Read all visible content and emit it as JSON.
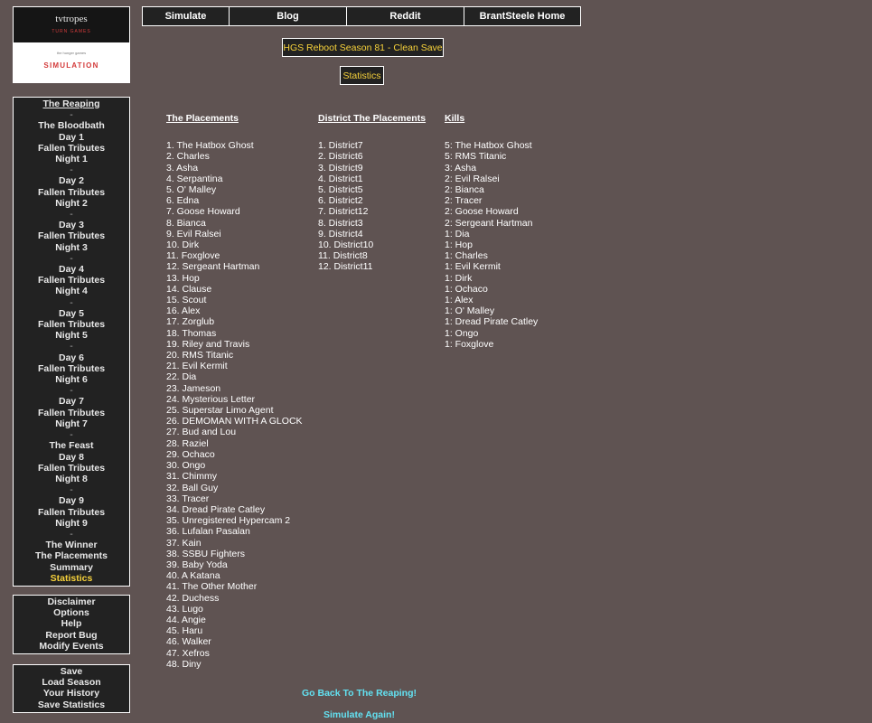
{
  "logo": {
    "tvtropes_text": "tvtropes",
    "tvtropes_sub": "TURN GAMES",
    "sim_text": "SIMULATION",
    "sim_tiny": "the hunger games"
  },
  "top_nav": [
    {
      "label": "Simulate"
    },
    {
      "label": "Blog"
    },
    {
      "label": "Reddit"
    },
    {
      "label": "BrantSteele Home"
    }
  ],
  "season_title": "HGS Reboot Season 81 - Clean Save",
  "page_title": "Statistics",
  "sidebar_nav": [
    {
      "label": "The Reaping",
      "type": "item"
    },
    {
      "label": "-",
      "type": "sep"
    },
    {
      "label": "The Bloodbath",
      "type": "item"
    },
    {
      "label": "Day 1",
      "type": "item"
    },
    {
      "label": "Fallen Tributes",
      "type": "item"
    },
    {
      "label": "Night 1",
      "type": "item"
    },
    {
      "label": "-",
      "type": "sep"
    },
    {
      "label": "Day 2",
      "type": "item"
    },
    {
      "label": "Fallen Tributes",
      "type": "item"
    },
    {
      "label": "Night 2",
      "type": "item"
    },
    {
      "label": "-",
      "type": "sep"
    },
    {
      "label": "Day 3",
      "type": "item"
    },
    {
      "label": "Fallen Tributes",
      "type": "item"
    },
    {
      "label": "Night 3",
      "type": "item"
    },
    {
      "label": "-",
      "type": "sep"
    },
    {
      "label": "Day 4",
      "type": "item"
    },
    {
      "label": "Fallen Tributes",
      "type": "item"
    },
    {
      "label": "Night 4",
      "type": "item"
    },
    {
      "label": "-",
      "type": "sep"
    },
    {
      "label": "Day 5",
      "type": "item"
    },
    {
      "label": "Fallen Tributes",
      "type": "item"
    },
    {
      "label": "Night 5",
      "type": "item"
    },
    {
      "label": "-",
      "type": "sep"
    },
    {
      "label": "Day 6",
      "type": "item"
    },
    {
      "label": "Fallen Tributes",
      "type": "item"
    },
    {
      "label": "Night 6",
      "type": "item"
    },
    {
      "label": "-",
      "type": "sep"
    },
    {
      "label": "Day 7",
      "type": "item"
    },
    {
      "label": "Fallen Tributes",
      "type": "item"
    },
    {
      "label": "Night 7",
      "type": "item"
    },
    {
      "label": "-",
      "type": "sep"
    },
    {
      "label": "The Feast",
      "type": "item"
    },
    {
      "label": "Day 8",
      "type": "item"
    },
    {
      "label": "Fallen Tributes",
      "type": "item"
    },
    {
      "label": "Night 8",
      "type": "item"
    },
    {
      "label": "-",
      "type": "sep"
    },
    {
      "label": "Day 9",
      "type": "item"
    },
    {
      "label": "Fallen Tributes",
      "type": "item"
    },
    {
      "label": "Night 9",
      "type": "item"
    },
    {
      "label": "-",
      "type": "sep"
    },
    {
      "label": "The Winner",
      "type": "item"
    },
    {
      "label": "The Placements",
      "type": "item"
    },
    {
      "label": "Summary",
      "type": "item"
    },
    {
      "label": "Statistics",
      "type": "selected"
    }
  ],
  "sidebar_misc": [
    "Disclaimer",
    "Options",
    "Help",
    "Report Bug",
    "Modify Events"
  ],
  "sidebar_save": [
    "Save",
    "Load Season",
    "Your History",
    "Save Statistics"
  ],
  "placements": {
    "heading": "The Placements",
    "rows": [
      "1. The Hatbox Ghost",
      "2. Charles",
      "3. Asha",
      "4. Serpantina",
      "5. O' Malley",
      "6. Edna",
      "7. Goose Howard",
      "8. Bianca",
      "9. Evil Ralsei",
      "10. Dirk",
      "11. Foxglove",
      "12. Sergeant Hartman",
      "13. Hop",
      "14. Clause",
      "15. Scout",
      "16. Alex",
      "17. Zorglub",
      "18. Thomas",
      "19. Riley and Travis",
      "20. RMS Titanic",
      "21. Evil Kermit",
      "22. Dia",
      "23. Jameson",
      "24. Mysterious Letter",
      "25. Superstar Limo Agent",
      "26. DEMOMAN WITH A GLOCK",
      "27. Bud and Lou",
      "28. Raziel",
      "29. Ochaco",
      "30. Ongo",
      "31. Chimmy",
      "32. Ball Guy",
      "33. Tracer",
      "34. Dread Pirate Catley",
      "35. Unregistered Hypercam 2",
      "36. Lufalan Pasalan",
      "37. Kain",
      "38. SSBU Fighters",
      "39. Baby Yoda",
      "40. A Katana",
      "41. The Other Mother",
      "42. Duchess",
      "43. Lugo",
      "44. Angie",
      "45. Haru",
      "46. Walker",
      "47. Xefros",
      "48. Diny"
    ]
  },
  "district_placements": {
    "heading": "District The Placements",
    "rows": [
      "1. District7",
      "2. District6",
      "3. District9",
      "4. District1",
      "5. District5",
      "6. District2",
      "7. District12",
      "8. District3",
      "9. District4",
      "10. District10",
      "11. District8",
      "12. District11"
    ]
  },
  "kills": {
    "heading": "Kills",
    "rows": [
      "5: The Hatbox Ghost",
      "5: RMS Titanic",
      "3: Asha",
      "2: Evil Ralsei",
      "2: Bianca",
      "2: Tracer",
      "2: Goose Howard",
      "2: Sergeant Hartman",
      "1: Dia",
      "1: Hop",
      "1: Charles",
      "1: Evil Kermit",
      "1: Dirk",
      "1: Ochaco",
      "1: Alex",
      "1: O' Malley",
      "1: Dread Pirate Catley",
      "1: Ongo",
      "1: Foxglove"
    ]
  },
  "links": {
    "go_back": "Go Back To The Reaping!",
    "simulate_again": "Simulate Again!"
  }
}
